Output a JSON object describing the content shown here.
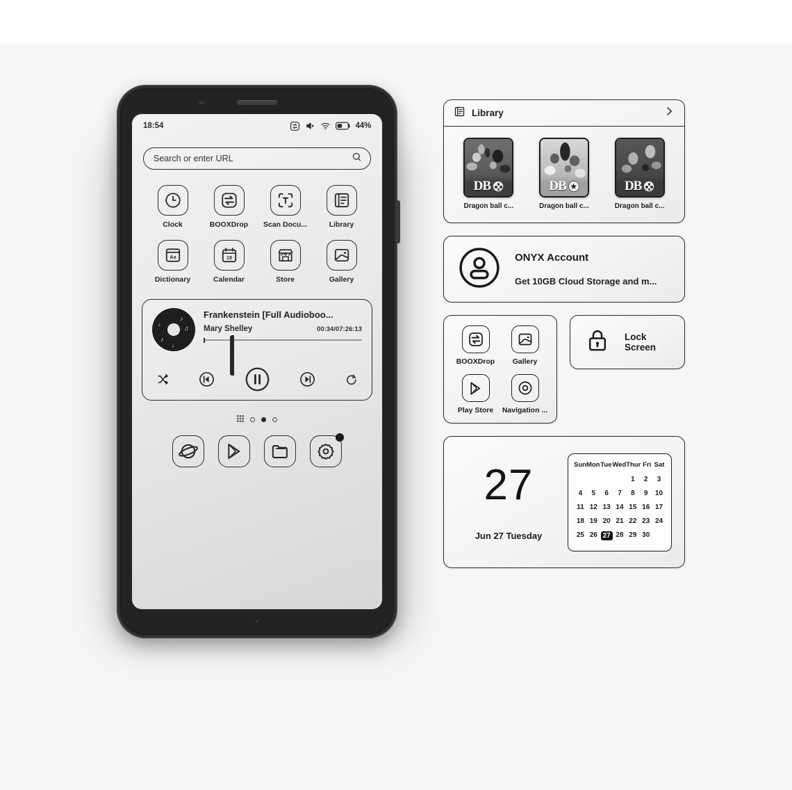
{
  "device": {
    "status_bar": {
      "time": "18:54",
      "icons": [
        "booxdrop-sync-icon",
        "volume-mute-icon",
        "wifi-icon",
        "battery-icon"
      ],
      "battery_percent": "44%"
    },
    "search": {
      "placeholder": "Search or enter URL",
      "icon": "search-icon"
    },
    "apps": [
      {
        "label": "Clock",
        "icon": "clock-icon"
      },
      {
        "label": "BOOXDrop",
        "icon": "booxdrop-icon"
      },
      {
        "label": "Scan Docu...",
        "icon": "scan-document-icon"
      },
      {
        "label": "Library",
        "icon": "library-icon"
      },
      {
        "label": "Dictionary",
        "icon": "dictionary-icon"
      },
      {
        "label": "Calendar",
        "icon": "calendar-icon"
      },
      {
        "label": "Store",
        "icon": "store-icon"
      },
      {
        "label": "Gallery",
        "icon": "gallery-icon"
      }
    ],
    "player": {
      "title": "Frankenstein [Full Audioboo...",
      "artist": "Mary Shelley",
      "time": "00:34/07:26:13",
      "album_art": "vinyl-record-icon",
      "controls": [
        "shuffle-icon",
        "previous-icon",
        "pause-icon",
        "next-icon",
        "repeat-icon"
      ]
    },
    "page_indicator": {
      "grid_icon": "app-drawer-icon",
      "pages": 3,
      "active": 3
    },
    "dock": [
      {
        "icon": "browser-icon",
        "name": "browser"
      },
      {
        "icon": "play-store-icon",
        "name": "play-store"
      },
      {
        "icon": "file-manager-icon",
        "name": "file-manager"
      },
      {
        "icon": "settings-gear-icon",
        "name": "settings",
        "badge": true
      }
    ]
  },
  "widgets": {
    "library": {
      "title": "Library",
      "header_icon": "library-icon",
      "chevron": "chevron-right-icon",
      "books": [
        {
          "name": "Dragon ball c...",
          "logo": "DB",
          "emblem": "four-star-ball"
        },
        {
          "name": "Dragon ball c...",
          "logo": "DB",
          "emblem": "star"
        },
        {
          "name": "Dragon ball c...",
          "logo": "DB",
          "emblem": "four-star-ball"
        }
      ]
    },
    "account": {
      "icon": "account-avatar-icon",
      "title": "ONYX Account",
      "subtitle": "Get 10GB Cloud Storage and m..."
    },
    "shortcuts": [
      {
        "label": "BOOXDrop",
        "icon": "booxdrop-icon"
      },
      {
        "label": "Gallery",
        "icon": "gallery-icon"
      },
      {
        "label": "Play Store",
        "icon": "play-store-icon"
      },
      {
        "label": "Navigation ...",
        "icon": "navigation-ball-icon"
      }
    ],
    "lock_screen": {
      "label": "Lock Screen",
      "icon": "lock-icon"
    },
    "calendar": {
      "big_date": "27",
      "caption": "Jun 27 Tuesday",
      "weekdays": [
        "Sun",
        "Mon",
        "Tue",
        "Wed",
        "Thur",
        "Fri",
        "Sat"
      ],
      "blanks_before": 4,
      "days": [
        1,
        2,
        3,
        4,
        5,
        6,
        7,
        8,
        9,
        10,
        11,
        12,
        13,
        14,
        15,
        16,
        17,
        18,
        19,
        20,
        21,
        22,
        23,
        24,
        25,
        26,
        27,
        28,
        29,
        30
      ],
      "today": 27
    }
  },
  "colors": {
    "page_background": "#f6f6f6",
    "phone_frame": "#2e2e2e",
    "screen_background": "#ebebeb",
    "ink": "#1d1d1d",
    "card_border": "#2c2c2c"
  }
}
